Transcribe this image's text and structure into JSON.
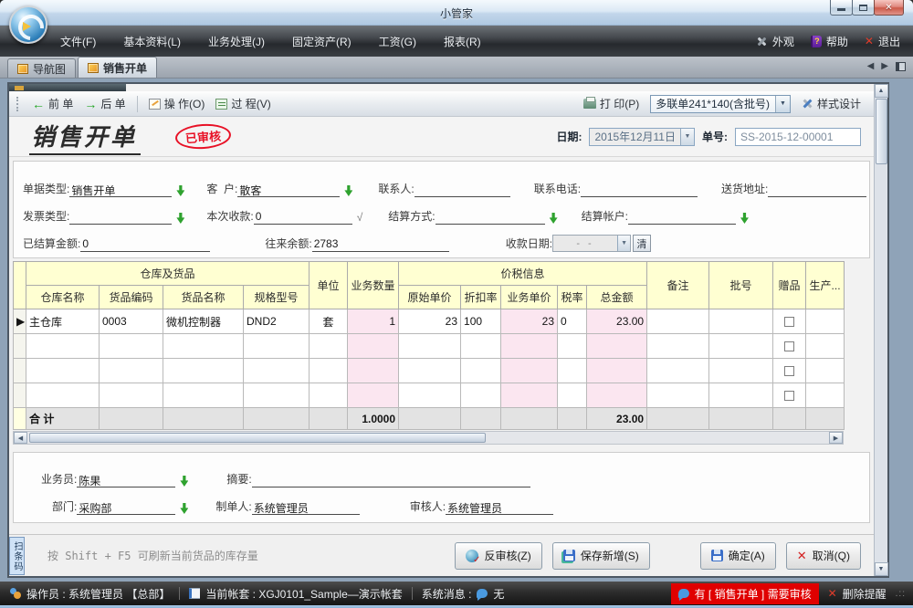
{
  "window": {
    "title": "小管家"
  },
  "menubar": {
    "items": [
      {
        "label": "文件(F)"
      },
      {
        "label": "基本资料(L)"
      },
      {
        "label": "业务处理(J)"
      },
      {
        "label": "固定资产(R)"
      },
      {
        "label": "工资(G)"
      },
      {
        "label": "报表(R)"
      }
    ],
    "appearance": "外观",
    "help": "帮助",
    "exit": "退出"
  },
  "tabs": [
    {
      "label": "导航图"
    },
    {
      "label": "销售开单"
    }
  ],
  "toolbar": {
    "prev": "前 单",
    "next": "后 单",
    "operate": "操 作(O)",
    "process": "过 程(V)",
    "print": "打 印(P)",
    "print_template": "多联单241*140(含批号)",
    "style_design": "样式设计"
  },
  "doc": {
    "title": "销售开单",
    "stamp": "已审核",
    "date_label": "日期:",
    "date_value": "2015年12月11日",
    "no_label": "单号:",
    "no_value": "SS-2015-12-00001"
  },
  "fields": {
    "bill_type_label": "单据类型:",
    "bill_type_value": "销售开单",
    "customer_label": "客  户:",
    "customer_value": "散客",
    "contact_label": "联系人:",
    "contact_value": "",
    "phone_label": "联系电话:",
    "phone_value": "",
    "address_label": "送货地址:",
    "address_value": "",
    "invoice_label": "发票类型:",
    "invoice_value": "",
    "payment_label": "本次收款:",
    "payment_value": "0",
    "settle_method_label": "结算方式:",
    "settle_method_value": "",
    "settle_account_label": "结算帐户:",
    "settle_account_value": "",
    "settled_label": "已结算金额:",
    "settled_value": "0",
    "balance_label": "往来余额:",
    "balance_value": "2783",
    "receipt_date_label": "收款日期:",
    "receipt_date_value": "-  -",
    "clear_button": "清"
  },
  "grid": {
    "group_warehouse": "仓库及货品",
    "group_price": "价税信息",
    "col_warehouse": "仓库名称",
    "col_code": "货品编码",
    "col_name": "货品名称",
    "col_spec": "规格型号",
    "col_unit": "单位",
    "col_qty": "业务数量",
    "col_orig_price": "原始单价",
    "col_discount": "折扣率",
    "col_price": "业务单价",
    "col_tax": "税率",
    "col_amount": "总金额",
    "col_remark": "备注",
    "col_batch": "批号",
    "col_gift": "赠品",
    "col_prod": "生产...",
    "row_indicator": "▶",
    "row": {
      "warehouse": "主仓库",
      "code": "0003",
      "name": "微机控制器",
      "spec": "DND2",
      "unit": "套",
      "qty": "1",
      "orig_price": "23",
      "discount": "100",
      "price": "23",
      "tax": "0",
      "amount": "23.00"
    },
    "total_label": "合 计",
    "total_qty": "1.0000",
    "total_amount": "23.00"
  },
  "footer": {
    "salesman_label": "业务员:",
    "salesman_value": "陈果",
    "summary_label": "摘要:",
    "summary_value": "",
    "dept_label": "部门:",
    "dept_value": "采购部",
    "maker_label": "制单人:",
    "maker_value": "系统管理员",
    "auditor_label": "审核人:",
    "auditor_value": "系统管理员"
  },
  "actions": {
    "barcode_tab": "扫条码",
    "hint": "按 Shift + F5 可刷新当前货品的库存量",
    "unaudit": "反审核(Z)",
    "save_new": "保存新增(S)",
    "ok": "确定(A)",
    "cancel": "取消(Q)"
  },
  "statusbar": {
    "operator": "操作员 : 系统管理员 【总部】",
    "account": "当前帐套 : XGJ0101_Sample—演示帐套",
    "sysmsg_label": "系统消息 :",
    "sysmsg_value": "无",
    "alert": "有 [ 销售开单 ] 需要审核",
    "delete_reminder": "删除提醒"
  },
  "colors": {
    "alert_bg": "#e00000",
    "stamp_red": "#e81126",
    "grid_header_bg": "#ffffd2",
    "grid_pink": "#fbe6f0",
    "green_arrow": "#2fa22f"
  }
}
